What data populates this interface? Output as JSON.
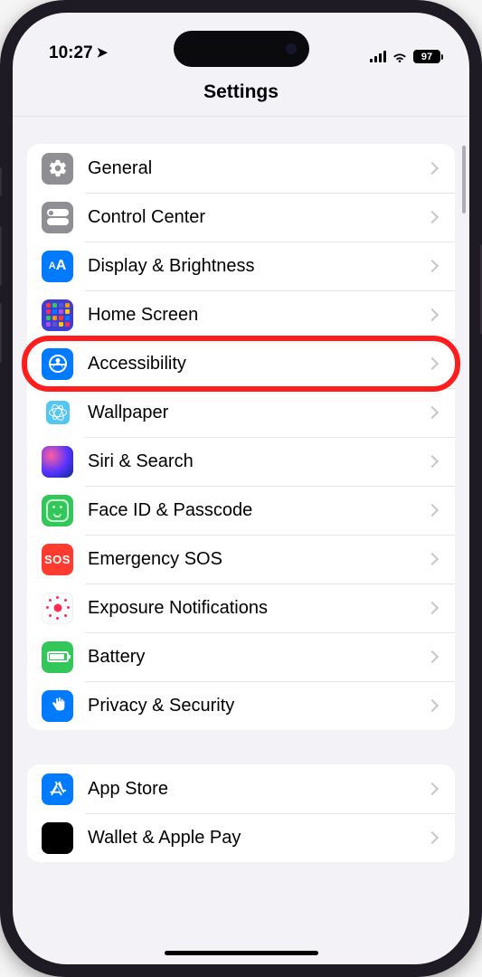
{
  "status_bar": {
    "time": "10:27",
    "battery_pct": "97"
  },
  "nav": {
    "title": "Settings"
  },
  "groups": [
    {
      "rows": [
        {
          "id": "general",
          "label": "General"
        },
        {
          "id": "control-center",
          "label": "Control Center"
        },
        {
          "id": "display",
          "label": "Display & Brightness"
        },
        {
          "id": "home-screen",
          "label": "Home Screen"
        },
        {
          "id": "accessibility",
          "label": "Accessibility",
          "highlighted": true
        },
        {
          "id": "wallpaper",
          "label": "Wallpaper"
        },
        {
          "id": "siri",
          "label": "Siri & Search"
        },
        {
          "id": "faceid",
          "label": "Face ID & Passcode"
        },
        {
          "id": "sos",
          "label": "Emergency SOS"
        },
        {
          "id": "exposure",
          "label": "Exposure Notifications"
        },
        {
          "id": "battery",
          "label": "Battery"
        },
        {
          "id": "privacy",
          "label": "Privacy & Security"
        }
      ]
    },
    {
      "rows": [
        {
          "id": "app-store",
          "label": "App Store"
        },
        {
          "id": "wallet",
          "label": "Wallet & Apple Pay"
        }
      ]
    }
  ]
}
